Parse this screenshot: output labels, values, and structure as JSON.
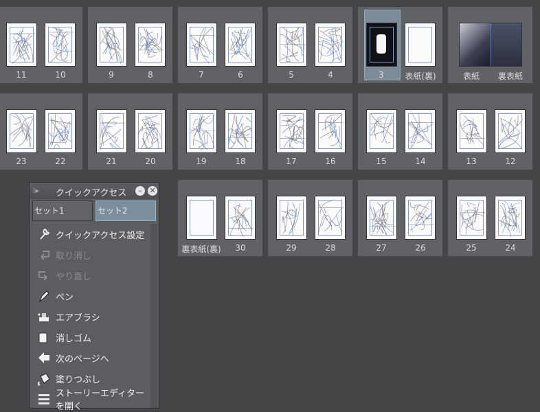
{
  "rows": [
    [
      {
        "left": "11",
        "right": "10"
      },
      {
        "left": "9",
        "right": "8"
      },
      {
        "left": "7",
        "right": "6"
      },
      {
        "left": "5",
        "right": "4"
      },
      {
        "left": "3",
        "right": "表紙(裏)",
        "selected": true
      },
      {
        "left": "表紙",
        "right": "裏表紙",
        "cover": true
      }
    ],
    [
      {
        "left": "23",
        "right": "22"
      },
      {
        "left": "21",
        "right": "20"
      },
      {
        "left": "19",
        "right": "18"
      },
      {
        "left": "17",
        "right": "16"
      },
      {
        "left": "15",
        "right": "14"
      },
      {
        "left": "13",
        "right": "12"
      }
    ],
    [
      {
        "left": "裏表紙(裏)",
        "right": "30",
        "blankLeft": true
      },
      {
        "left": "29",
        "right": "28"
      },
      {
        "left": "27",
        "right": "26"
      },
      {
        "left": "25",
        "right": "24"
      }
    ]
  ],
  "quickAccess": {
    "title": "クイックアクセス",
    "minimize_icon": "minimize-icon",
    "close_icon": "close-icon",
    "tabs": [
      "セット1",
      "セット2"
    ],
    "active_tab": 1,
    "items": [
      {
        "label": "クイックアクセス設定",
        "icon": "wrench-icon",
        "enabled": true
      },
      {
        "label": "取り消し",
        "icon": "undo-icon",
        "enabled": false
      },
      {
        "label": "やり直し",
        "icon": "redo-icon",
        "enabled": false
      },
      {
        "label": "ペン",
        "icon": "pen-icon",
        "enabled": true
      },
      {
        "label": "エアブラシ",
        "icon": "airbrush-icon",
        "enabled": true
      },
      {
        "label": "消しゴム",
        "icon": "eraser-icon",
        "enabled": true
      },
      {
        "label": "次のページへ",
        "icon": "next-page-icon",
        "enabled": true
      },
      {
        "label": "塗りつぶし",
        "icon": "fill-bucket-icon",
        "enabled": true
      },
      {
        "label": "ストーリーエディターを開く",
        "icon": "story-editor-icon",
        "enabled": true
      }
    ]
  }
}
